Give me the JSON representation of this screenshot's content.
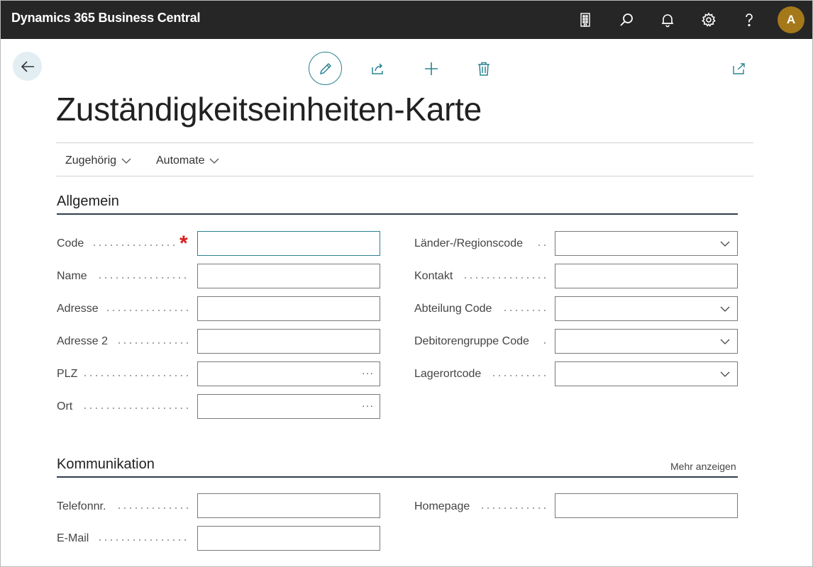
{
  "app": {
    "title": "Dynamics 365 Business Central",
    "user_initial": "A"
  },
  "icons": {
    "company": "company-icon",
    "search": "search-icon",
    "notifications": "bell-icon",
    "settings": "gear-icon",
    "help": "help-icon",
    "back": "back-arrow-icon",
    "edit": "pencil-icon",
    "share": "share-icon",
    "new": "plus-icon",
    "delete": "trash-icon",
    "open_new": "open-in-new-window-icon"
  },
  "colors": {
    "accent": "#2a8390",
    "topbar": "#262626",
    "avatar": "#a5791a",
    "required": "#d81e1e"
  },
  "page": {
    "title": "Zuständigkeitseinheiten-Karte"
  },
  "menu": {
    "related": "Zugehörig",
    "automate": "Automate"
  },
  "general": {
    "title": "Allgemein",
    "code_label": "Code",
    "code_required": "*",
    "name_label": "Name",
    "address_label": "Adresse",
    "address2_label": "Adresse 2",
    "postcode_label": "PLZ",
    "postcode_lookup": "···",
    "city_label": "Ort",
    "city_lookup": "···",
    "country_label": "Länder-/Regionscode",
    "contact_label": "Kontakt",
    "department_label": "Abteilung Code",
    "customer_group_label": "Debitorengruppe Code",
    "location_label": "Lagerortcode"
  },
  "communication": {
    "title": "Kommunikation",
    "show_more": "Mehr anzeigen",
    "phone_label": "Telefonnr.",
    "email_label": "E-Mail",
    "homepage_label": "Homepage"
  }
}
